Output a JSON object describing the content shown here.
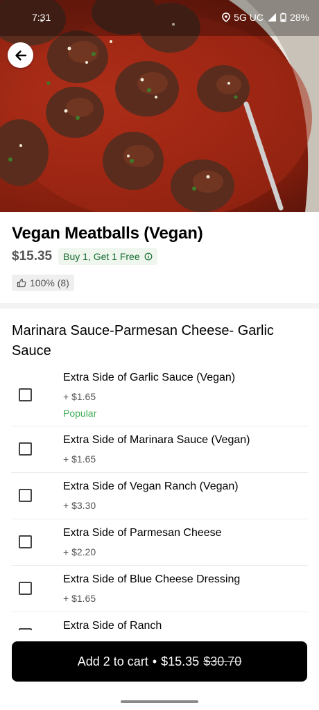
{
  "status_bar": {
    "time": "7:31",
    "network": "5G UC",
    "battery": "28%",
    "icons": [
      "location-icon",
      "signal-icon",
      "battery-icon"
    ]
  },
  "header": {
    "back_icon": "arrow-left-icon"
  },
  "item": {
    "title": "Vegan Meatballs (Vegan)",
    "price": "$15.35",
    "promo": "Buy 1, Get 1 Free",
    "promo_icon": "info-icon",
    "rating": "100% (8)",
    "rating_icon": "thumbs-up-icon"
  },
  "section": {
    "title": "Marinara Sauce-Parmesan Cheese- Garlic Sauce"
  },
  "options": [
    {
      "label": "Extra Side of Garlic Sauce (Vegan)",
      "price": "+ $1.65",
      "tag": "Popular",
      "checked": false
    },
    {
      "label": "Extra Side of Marinara Sauce (Vegan)",
      "price": "+ $1.65",
      "checked": false
    },
    {
      "label": "Extra Side of Vegan Ranch (Vegan)",
      "price": "+ $3.30",
      "checked": false
    },
    {
      "label": "Extra Side of Parmesan Cheese",
      "price": "+ $2.20",
      "checked": false
    },
    {
      "label": "Extra Side of Blue Cheese Dressing",
      "price": "+ $1.65",
      "checked": false
    },
    {
      "label": "Extra Side of Ranch",
      "checked": false
    }
  ],
  "cart_button": {
    "label": "Add 2 to cart",
    "separator": "•",
    "price": "$15.35",
    "original_price": "$30.70"
  },
  "colors": {
    "promo_bg": "#eef6ee",
    "promo_text": "#156b2e",
    "popular": "#3fae56",
    "button_bg": "#000000"
  }
}
